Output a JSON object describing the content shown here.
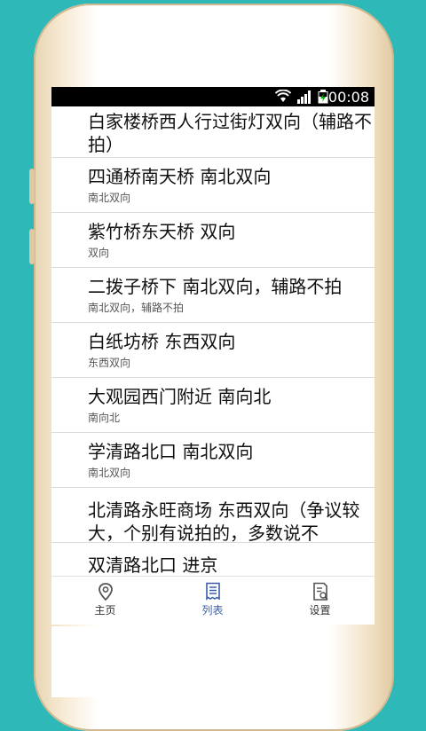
{
  "status_bar": {
    "time": "00:08"
  },
  "list": {
    "items": [
      {
        "title": "白家楼桥西人行过街灯双向（辅路不拍）",
        "subtitle": ""
      },
      {
        "title": "四通桥南天桥 南北双向",
        "subtitle": "南北双向"
      },
      {
        "title": "紫竹桥东天桥 双向",
        "subtitle": "双向"
      },
      {
        "title": "二拨子桥下 南北双向，辅路不拍",
        "subtitle": "南北双向，辅路不拍"
      },
      {
        "title": "白纸坊桥 东西双向",
        "subtitle": "东西双向"
      },
      {
        "title": "大观园西门附近 南向北",
        "subtitle": "南向北"
      },
      {
        "title": "学清路北口 南北双向",
        "subtitle": "南北双向"
      },
      {
        "title": "北清路永旺商场 东西双向（争议较大，个别有说拍的，多数说不",
        "subtitle": ""
      },
      {
        "title": "双清路北口 进京",
        "subtitle": ""
      }
    ]
  },
  "tabbar": {
    "tabs": [
      {
        "label": "主页",
        "icon": "location-pin-icon"
      },
      {
        "label": "列表",
        "icon": "list-document-icon"
      },
      {
        "label": "设置",
        "icon": "settings-document-icon"
      }
    ],
    "active_index": 1,
    "active_color": "#3b5fa8"
  }
}
